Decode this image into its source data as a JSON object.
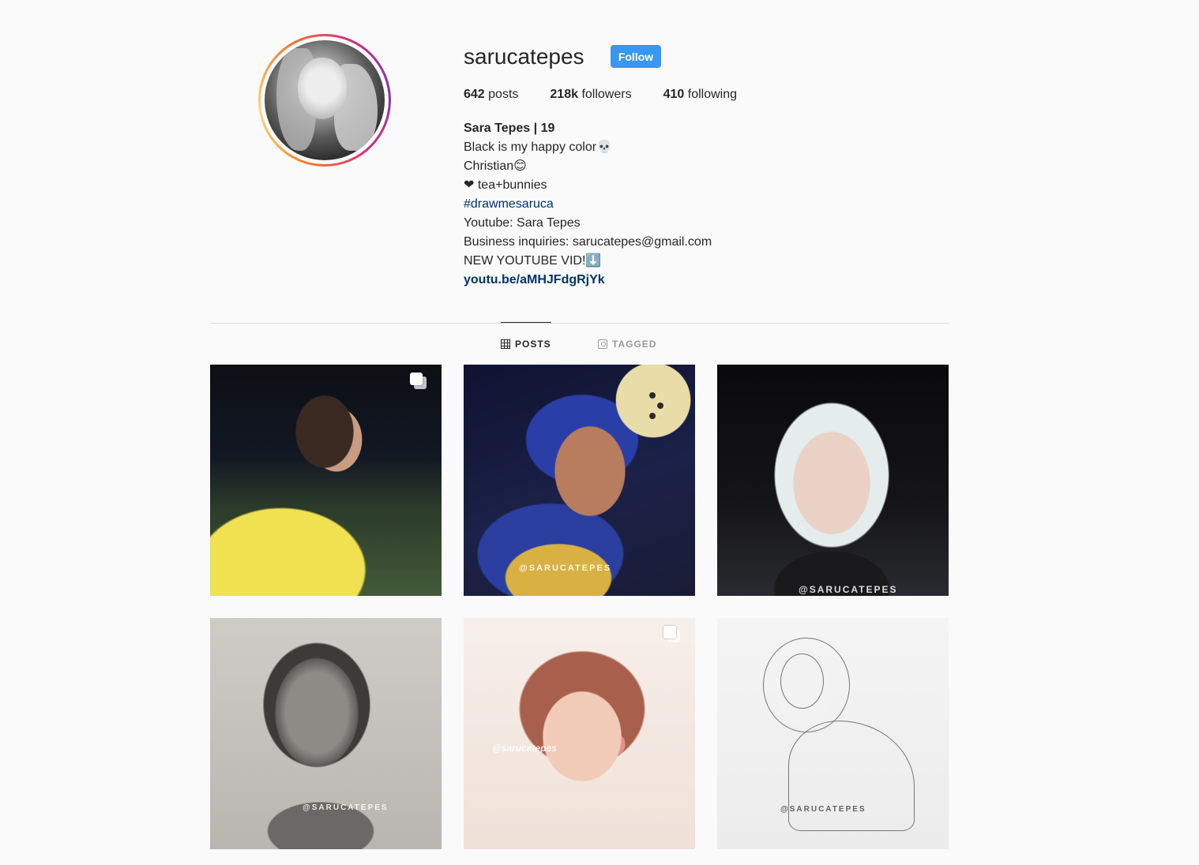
{
  "profile": {
    "username": "sarucatepes",
    "follow_label": "Follow",
    "stats": {
      "posts_count": "642",
      "posts_label": "posts",
      "followers_count": "218k",
      "followers_label": "followers",
      "following_count": "410",
      "following_label": "following"
    },
    "bio": {
      "name": "Sara Tepes | 19",
      "line1": "Black is my happy color💀",
      "line2": "Christian😊",
      "line3": "❤ tea+bunnies",
      "hashtag": "#drawmesaruca",
      "line5": "Youtube: Sara Tepes",
      "line6": "Business inquiries: sarucatepes@gmail.com",
      "line7": "NEW YOUTUBE VID!⬇️",
      "link": "youtu.be/aMHJFdgRjYk"
    }
  },
  "tabs": {
    "posts": "POSTS",
    "tagged": "TAGGED"
  },
  "posts": {
    "p2_watermark": "@SARUCATEPES",
    "p3_watermark": "@SARUCATEPES",
    "p4_watermark": "@SARUCATEPES",
    "p5_watermark": "@sarucatepes",
    "p6_watermark": "@SARUCATEPES"
  },
  "colors": {
    "follow_button": "#3897f0",
    "link": "#003569",
    "background": "#fafafa"
  }
}
